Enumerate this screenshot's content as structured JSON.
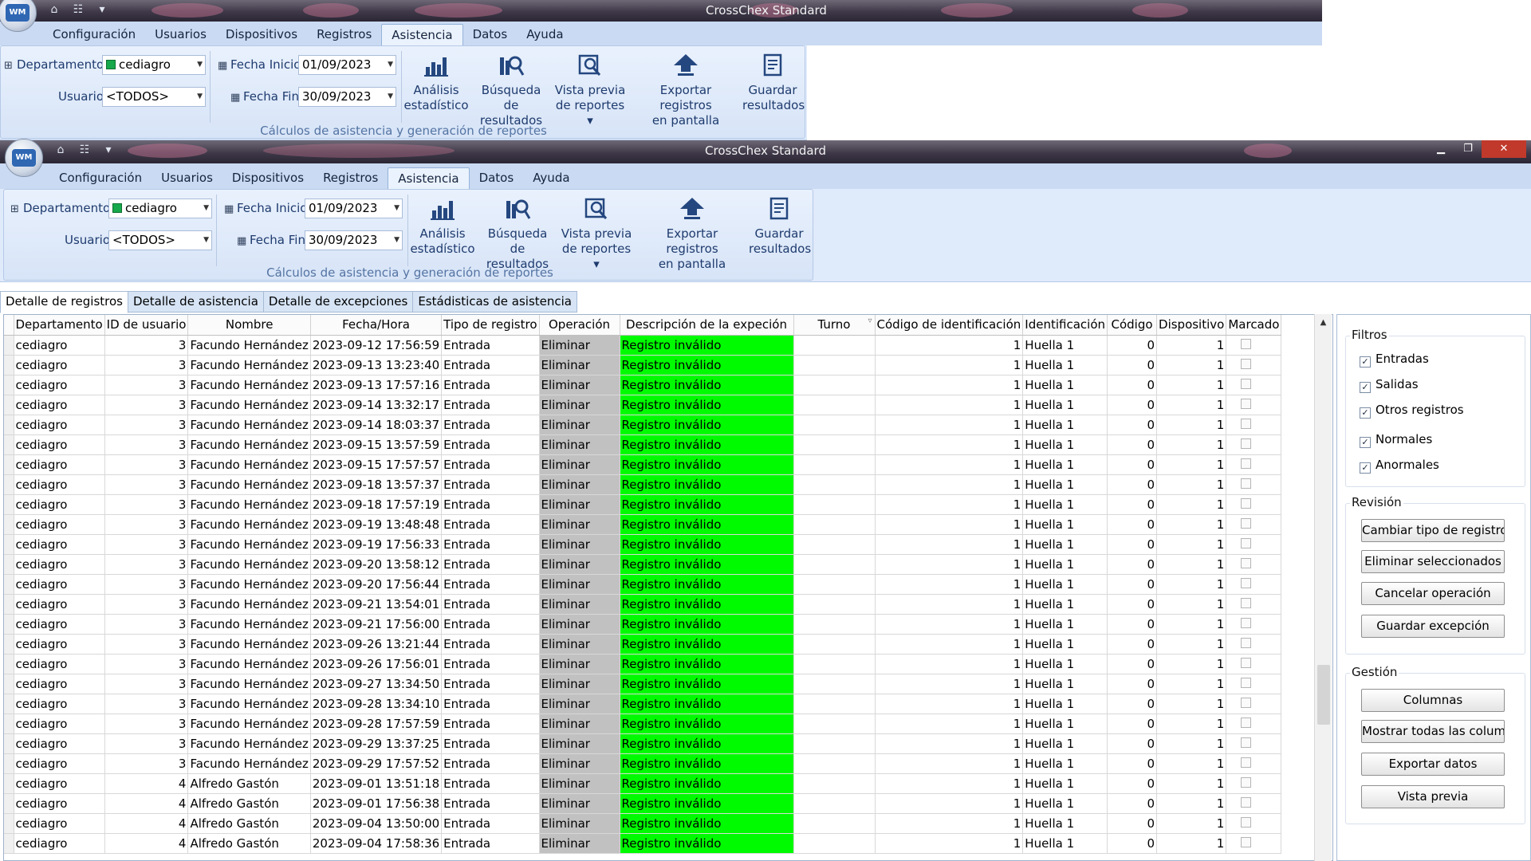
{
  "app": {
    "title": "CrossChex Standard"
  },
  "menu": [
    "Configuración",
    "Usuarios",
    "Dispositivos",
    "Registros",
    "Asistencia",
    "Datos",
    "Ayuda"
  ],
  "ribbon": {
    "department_label": "Departamento",
    "department_value": "cediagro",
    "user_label": "Usuario",
    "user_value": "<TODOS>",
    "start_label": "Fecha Inicio",
    "start_value": "01/09/2023",
    "end_label": "Fecha Fin",
    "end_value": "30/09/2023",
    "btn_analysis": [
      "Análisis",
      "estadístico"
    ],
    "btn_search": [
      "Búsqueda de",
      "resultados"
    ],
    "btn_preview": [
      "Vista previa",
      "de reportes"
    ],
    "btn_export": [
      "Exportar registros",
      "en pantalla"
    ],
    "btn_save": [
      "Guardar",
      "resultados"
    ],
    "group_caption": "Cálculos de asistencia y generación de reportes"
  },
  "tabs": [
    "Detalle de registros",
    "Detalle de asistencia",
    "Detalle de excepciones",
    "Estádisticas de asistencia"
  ],
  "columns": [
    "Departamento",
    "ID de usuario",
    "Nombre",
    "Fecha/Hora",
    "Tipo de registro",
    "Operación",
    "Descripción de la expeción",
    "Turno",
    "Código de identificación",
    "Identificación",
    "Código",
    "Dispositivo",
    "Marcado"
  ],
  "rows": [
    [
      "cediagro",
      "3",
      "Facundo Hernández",
      "2023-09-12 17:56:59",
      "Entrada",
      "Eliminar",
      "Registro inválido",
      "",
      "1",
      "Huella 1",
      "0",
      "1"
    ],
    [
      "cediagro",
      "3",
      "Facundo Hernández",
      "2023-09-13 13:23:40",
      "Entrada",
      "Eliminar",
      "Registro inválido",
      "",
      "1",
      "Huella 1",
      "0",
      "1"
    ],
    [
      "cediagro",
      "3",
      "Facundo Hernández",
      "2023-09-13 17:57:16",
      "Entrada",
      "Eliminar",
      "Registro inválido",
      "",
      "1",
      "Huella 1",
      "0",
      "1"
    ],
    [
      "cediagro",
      "3",
      "Facundo Hernández",
      "2023-09-14 13:32:17",
      "Entrada",
      "Eliminar",
      "Registro inválido",
      "",
      "1",
      "Huella 1",
      "0",
      "1"
    ],
    [
      "cediagro",
      "3",
      "Facundo Hernández",
      "2023-09-14 18:03:37",
      "Entrada",
      "Eliminar",
      "Registro inválido",
      "",
      "1",
      "Huella 1",
      "0",
      "1"
    ],
    [
      "cediagro",
      "3",
      "Facundo Hernández",
      "2023-09-15 13:57:59",
      "Entrada",
      "Eliminar",
      "Registro inválido",
      "",
      "1",
      "Huella 1",
      "0",
      "1"
    ],
    [
      "cediagro",
      "3",
      "Facundo Hernández",
      "2023-09-15 17:57:57",
      "Entrada",
      "Eliminar",
      "Registro inválido",
      "",
      "1",
      "Huella 1",
      "0",
      "1"
    ],
    [
      "cediagro",
      "3",
      "Facundo Hernández",
      "2023-09-18 13:57:37",
      "Entrada",
      "Eliminar",
      "Registro inválido",
      "",
      "1",
      "Huella 1",
      "0",
      "1"
    ],
    [
      "cediagro",
      "3",
      "Facundo Hernández",
      "2023-09-18 17:57:19",
      "Entrada",
      "Eliminar",
      "Registro inválido",
      "",
      "1",
      "Huella 1",
      "0",
      "1"
    ],
    [
      "cediagro",
      "3",
      "Facundo Hernández",
      "2023-09-19 13:48:48",
      "Entrada",
      "Eliminar",
      "Registro inválido",
      "",
      "1",
      "Huella 1",
      "0",
      "1"
    ],
    [
      "cediagro",
      "3",
      "Facundo Hernández",
      "2023-09-19 17:56:33",
      "Entrada",
      "Eliminar",
      "Registro inválido",
      "",
      "1",
      "Huella 1",
      "0",
      "1"
    ],
    [
      "cediagro",
      "3",
      "Facundo Hernández",
      "2023-09-20 13:58:12",
      "Entrada",
      "Eliminar",
      "Registro inválido",
      "",
      "1",
      "Huella 1",
      "0",
      "1"
    ],
    [
      "cediagro",
      "3",
      "Facundo Hernández",
      "2023-09-20 17:56:44",
      "Entrada",
      "Eliminar",
      "Registro inválido",
      "",
      "1",
      "Huella 1",
      "0",
      "1"
    ],
    [
      "cediagro",
      "3",
      "Facundo Hernández",
      "2023-09-21 13:54:01",
      "Entrada",
      "Eliminar",
      "Registro inválido",
      "",
      "1",
      "Huella 1",
      "0",
      "1"
    ],
    [
      "cediagro",
      "3",
      "Facundo Hernández",
      "2023-09-21 17:56:00",
      "Entrada",
      "Eliminar",
      "Registro inválido",
      "",
      "1",
      "Huella 1",
      "0",
      "1"
    ],
    [
      "cediagro",
      "3",
      "Facundo Hernández",
      "2023-09-26 13:21:44",
      "Entrada",
      "Eliminar",
      "Registro inválido",
      "",
      "1",
      "Huella 1",
      "0",
      "1"
    ],
    [
      "cediagro",
      "3",
      "Facundo Hernández",
      "2023-09-26 17:56:01",
      "Entrada",
      "Eliminar",
      "Registro inválido",
      "",
      "1",
      "Huella 1",
      "0",
      "1"
    ],
    [
      "cediagro",
      "3",
      "Facundo Hernández",
      "2023-09-27 13:34:50",
      "Entrada",
      "Eliminar",
      "Registro inválido",
      "",
      "1",
      "Huella 1",
      "0",
      "1"
    ],
    [
      "cediagro",
      "3",
      "Facundo Hernández",
      "2023-09-28 13:34:10",
      "Entrada",
      "Eliminar",
      "Registro inválido",
      "",
      "1",
      "Huella 1",
      "0",
      "1"
    ],
    [
      "cediagro",
      "3",
      "Facundo Hernández",
      "2023-09-28 17:57:59",
      "Entrada",
      "Eliminar",
      "Registro inválido",
      "",
      "1",
      "Huella 1",
      "0",
      "1"
    ],
    [
      "cediagro",
      "3",
      "Facundo Hernández",
      "2023-09-29 13:37:25",
      "Entrada",
      "Eliminar",
      "Registro inválido",
      "",
      "1",
      "Huella 1",
      "0",
      "1"
    ],
    [
      "cediagro",
      "3",
      "Facundo Hernández",
      "2023-09-29 17:57:52",
      "Entrada",
      "Eliminar",
      "Registro inválido",
      "",
      "1",
      "Huella 1",
      "0",
      "1"
    ],
    [
      "cediagro",
      "4",
      "Alfredo Gastón",
      "2023-09-01 13:51:18",
      "Entrada",
      "Eliminar",
      "Registro inválido",
      "",
      "1",
      "Huella 1",
      "0",
      "1"
    ],
    [
      "cediagro",
      "4",
      "Alfredo Gastón",
      "2023-09-01 17:56:38",
      "Entrada",
      "Eliminar",
      "Registro inválido",
      "",
      "1",
      "Huella 1",
      "0",
      "1"
    ],
    [
      "cediagro",
      "4",
      "Alfredo Gastón",
      "2023-09-04 13:50:00",
      "Entrada",
      "Eliminar",
      "Registro inválido",
      "",
      "1",
      "Huella 1",
      "0",
      "1"
    ],
    [
      "cediagro",
      "4",
      "Alfredo Gastón",
      "2023-09-04 17:58:36",
      "Entrada",
      "Eliminar",
      "Registro inválido",
      "",
      "1",
      "Huella 1",
      "0",
      "1"
    ]
  ],
  "filters": {
    "title": "Filtros",
    "items": [
      "Entradas",
      "Salidas",
      "Otros registros",
      "Normales",
      "Anormales"
    ]
  },
  "review": {
    "title": "Revisión",
    "buttons": [
      "Cambiar tipo de registro",
      "Eliminar seleccionados",
      "Cancelar operación",
      "Guardar excepción"
    ]
  },
  "management": {
    "title": "Gestión",
    "buttons": [
      "Columnas",
      "Mostrar todas las columnas",
      "Exportar datos",
      "Vista previa"
    ]
  },
  "colors": {
    "desc_cell": "#00fb00",
    "operation_cell": "#c1c1c1",
    "menubar": "#c9daf2",
    "ribbon": "#dfeafb"
  }
}
